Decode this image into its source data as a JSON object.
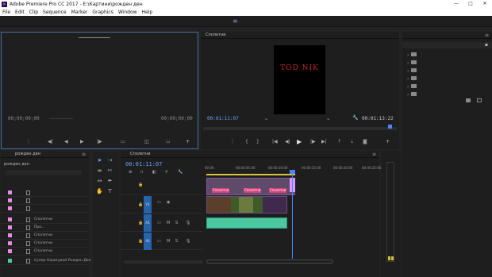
{
  "window": {
    "title": "Adobe Premiere Pro CC 2017 - E:\\Картини\\рожден ден",
    "app_badge": "Pr",
    "min_glyph": "—",
    "max_glyph": "□",
    "close_glyph": "✕"
  },
  "menu": [
    "File",
    "Edit",
    "Clip",
    "Sequence",
    "Marker",
    "Graphics",
    "Window",
    "Help"
  ],
  "source_monitor": {
    "timecode_in": "00;00;00;00",
    "timecode_out": "00;00;00;00",
    "add_glyph": "+"
  },
  "program_monitor": {
    "tab": "Сполетни",
    "overlay_text": "TOD NIK",
    "timecode_current": "00:01:11:07",
    "timecode_duration": "00:01:13:22",
    "add_glyph": "+"
  },
  "project_panel": {
    "title": "рожден ден",
    "subtitle": "рожден ден",
    "rows": [
      {
        "label": ""
      },
      {
        "label": ""
      },
      {
        "label": ""
      },
      {
        "label": "Сполетни"
      },
      {
        "label": "Про..."
      },
      {
        "label": "Сполетни"
      },
      {
        "label": "Сполетни"
      },
      {
        "label": "Сполетни"
      },
      {
        "label": "Супер Нарисувай Рожден Ден"
      }
    ]
  },
  "timeline": {
    "tab": "Сполетни",
    "timecode": "00:01:11:07",
    "ruler": [
      "00:00",
      "00:00:05:00",
      "00:00:10:00",
      "00:00:15:00",
      "00:00:20:00",
      "00:00:25:00"
    ],
    "track_names": [
      "V1",
      "A1",
      "A2"
    ],
    "clip_labels": [
      "Сполетни",
      "Сполетни",
      "Сполетни"
    ],
    "track_letter_m": "M",
    "track_letter_s": "S"
  },
  "colors": {
    "accent_blue": "#4f83ff",
    "label_pink": "#e48be3",
    "audio_green": "#4bc8a1"
  }
}
